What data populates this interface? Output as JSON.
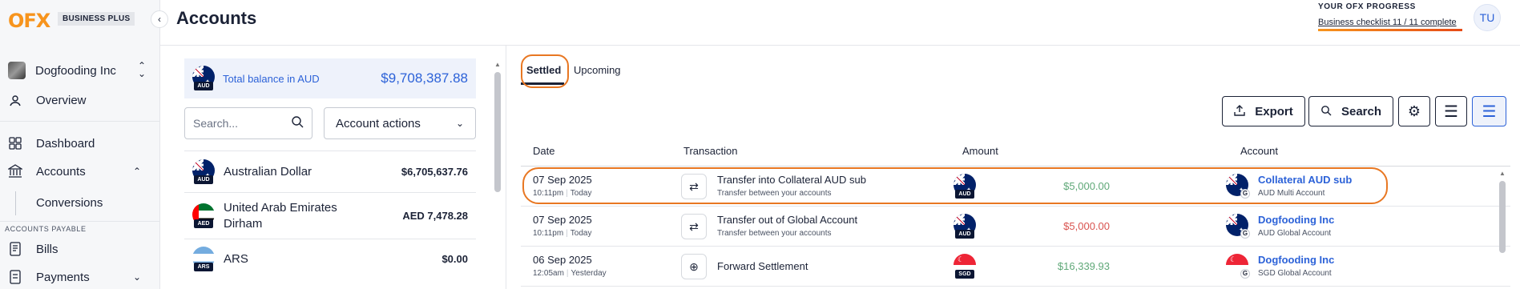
{
  "brand": {
    "logo": "OFX",
    "plan": "BUSINESS PLUS"
  },
  "sidebar": {
    "org_name": "Dogfooding Inc",
    "items": [
      {
        "label": "Overview",
        "icon": "user-circle-icon"
      },
      {
        "label": "Dashboard",
        "icon": "grid-icon"
      },
      {
        "label": "Accounts",
        "icon": "bank-icon"
      },
      {
        "label": "Conversions"
      },
      {
        "label": "Bills",
        "icon": "document-icon"
      },
      {
        "label": "Payments",
        "icon": "payment-icon"
      }
    ],
    "section_payable": "ACCOUNTS PAYABLE"
  },
  "header": {
    "title": "Accounts",
    "progress_title": "YOUR OFX PROGRESS",
    "progress_text": "Business checklist 11 / 11 complete",
    "progress_fraction": 1.0,
    "user_initials": "TU"
  },
  "left_panel": {
    "total_label": "Total balance in AUD",
    "total_value": "$9,708,387.88",
    "total_flag_code": "AUD",
    "search_placeholder": "Search...",
    "actions_label": "Account actions",
    "accounts": [
      {
        "name": "Australian Dollar",
        "balance": "$6,705,637.76",
        "code": "AUD"
      },
      {
        "name": "United Arab Emirates Dirham",
        "balance": "AED 7,478.28",
        "code": "AED"
      },
      {
        "name": "ARS",
        "balance": "$0.00",
        "code": "ARS"
      }
    ]
  },
  "tabs": {
    "settled": "Settled",
    "upcoming": "Upcoming"
  },
  "toolbar": {
    "export": "Export",
    "search": "Search"
  },
  "table": {
    "columns": {
      "date": "Date",
      "transaction": "Transaction",
      "amount": "Amount",
      "account": "Account"
    },
    "rows": [
      {
        "date": "07 Sep 2025",
        "time": "10:11pm",
        "day": "Today",
        "title": "Transfer into Collateral AUD sub",
        "subtitle": "Transfer between your accounts",
        "amount_code": "AUD",
        "amount": "$5,000.00",
        "direction": "in",
        "account_name": "Collateral AUD sub",
        "account_sub": "AUD Multi Account",
        "account_code": "AUD"
      },
      {
        "date": "07 Sep 2025",
        "time": "10:11pm",
        "day": "Today",
        "title": "Transfer out of Global Account",
        "subtitle": "Transfer between your accounts",
        "amount_code": "AUD",
        "amount": "$5,000.00",
        "direction": "out",
        "account_name": "Dogfooding Inc",
        "account_sub": "AUD Global Account",
        "account_code": "AUD"
      },
      {
        "date": "06 Sep 2025",
        "time": "12:05am",
        "day": "Yesterday",
        "title": "Forward Settlement",
        "subtitle": "",
        "amount_code": "SGD",
        "amount": "$16,339.93",
        "direction": "in",
        "account_name": "Dogfooding Inc",
        "account_sub": "SGD Global Account",
        "account_code": "SGD"
      }
    ]
  },
  "colors": {
    "brand_orange": "#f7941d",
    "link_blue": "#2c62d8",
    "positive": "#5fa878",
    "negative": "#d9534f",
    "highlight": "#e87722"
  }
}
